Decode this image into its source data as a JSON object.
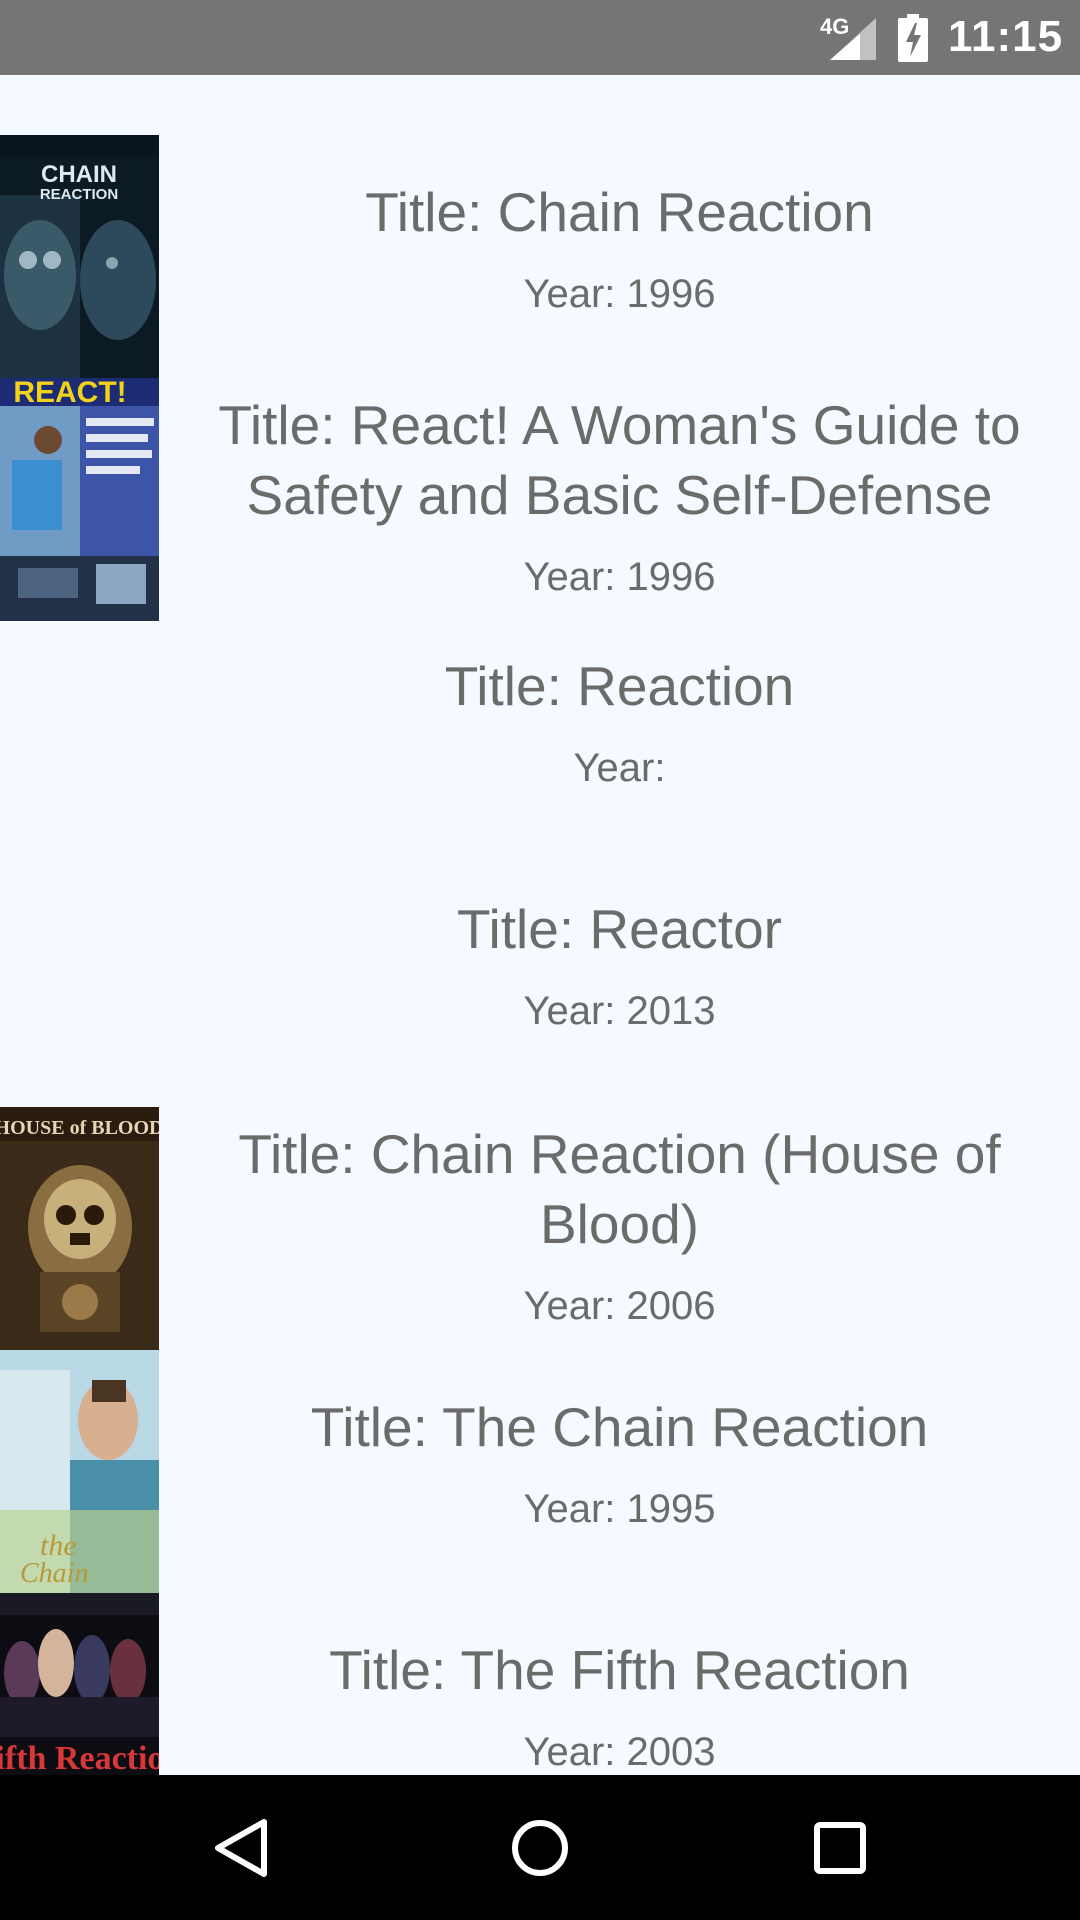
{
  "status_bar": {
    "network": "4G",
    "time": "11:15"
  },
  "movies": [
    {
      "title": "Title: Chain Reaction",
      "year": "Year: 1996",
      "poster": "chain-reaction-poster",
      "poster_text": "CHAIN REACTION"
    },
    {
      "title": "Title: React! A Woman's Guide to Safety and Basic Self-Defense",
      "year": "Year: 1996",
      "poster": "react-poster",
      "poster_text": "REACT!"
    },
    {
      "title": "Title: Reaction",
      "year": "Year:",
      "poster": null
    },
    {
      "title": "Title: Reactor",
      "year": "Year: 2013",
      "poster": null
    },
    {
      "title": "Title: Chain Reaction (House of Blood)",
      "year": "Year: 2006",
      "poster": "house-of-blood-poster",
      "poster_text": "HOUSE of BLOOD"
    },
    {
      "title": "Title: The Chain Reaction",
      "year": "Year: 1995",
      "poster": "the-chain-reaction-poster",
      "poster_text": "the Chain Reaction"
    },
    {
      "title": "Title: The Fifth Reaction",
      "year": "Year: 2003",
      "poster": "fifth-reaction-poster",
      "poster_text": "Fifth Reaction"
    }
  ],
  "nav_bar": {
    "back_icon": "back-triangle-icon",
    "home_icon": "home-circle-icon",
    "recents_icon": "recents-square-icon"
  },
  "colors": {
    "status_bar": "#757575",
    "background": "#f4faff",
    "text": "#6b6b6b",
    "nav_bar": "#000000"
  }
}
